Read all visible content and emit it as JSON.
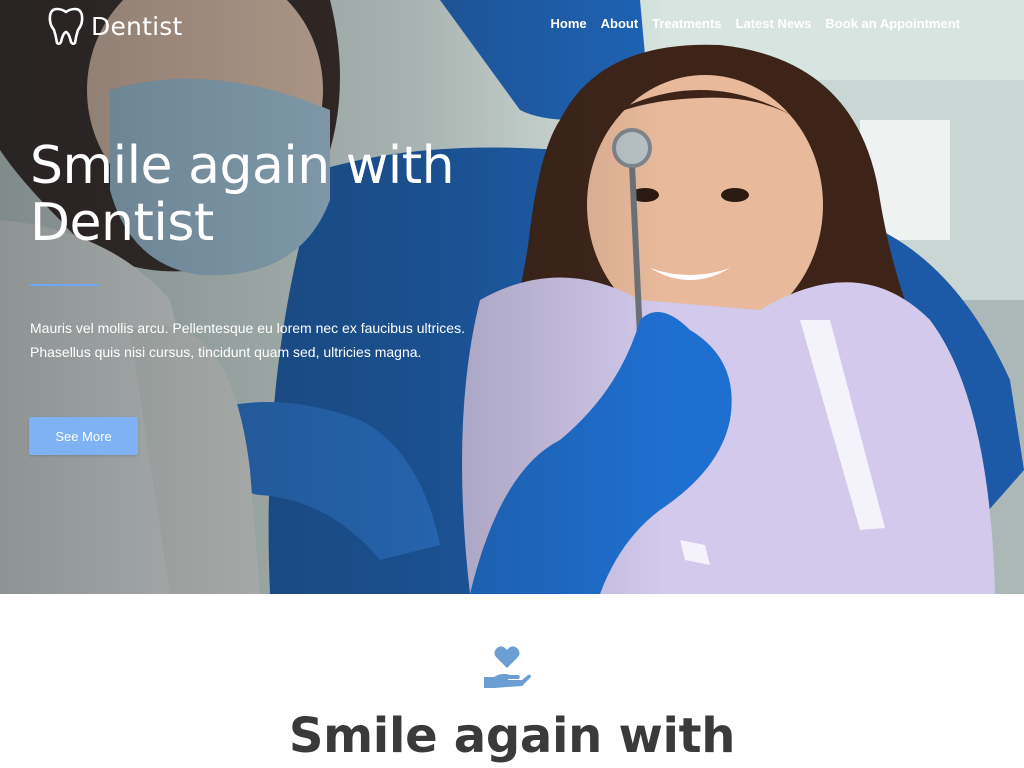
{
  "brand": {
    "name": "Dentist",
    "icon": "tooth-icon"
  },
  "nav": {
    "items": [
      {
        "label": "Home"
      },
      {
        "label": "About"
      },
      {
        "label": "Treatments"
      },
      {
        "label": "Latest News"
      },
      {
        "label": "Book an Appointment"
      }
    ]
  },
  "hero": {
    "title": "Smile again with Dentist",
    "text": "Mauris vel mollis arcu. Pellentesque eu lorem nec ex faucibus ultrices. Phasellus quis nisi cursus, tincidunt quam sed, ultricies magna.",
    "button_label": "See More",
    "image": "dentist-examining-child-photo"
  },
  "section": {
    "icon": "heart-in-hand-icon",
    "title": "Smile again with"
  },
  "colors": {
    "accent": "#7fb1f5",
    "rule": "#6fa8f0",
    "icon": "#6b9fd4",
    "heading": "#3a3a3a"
  }
}
